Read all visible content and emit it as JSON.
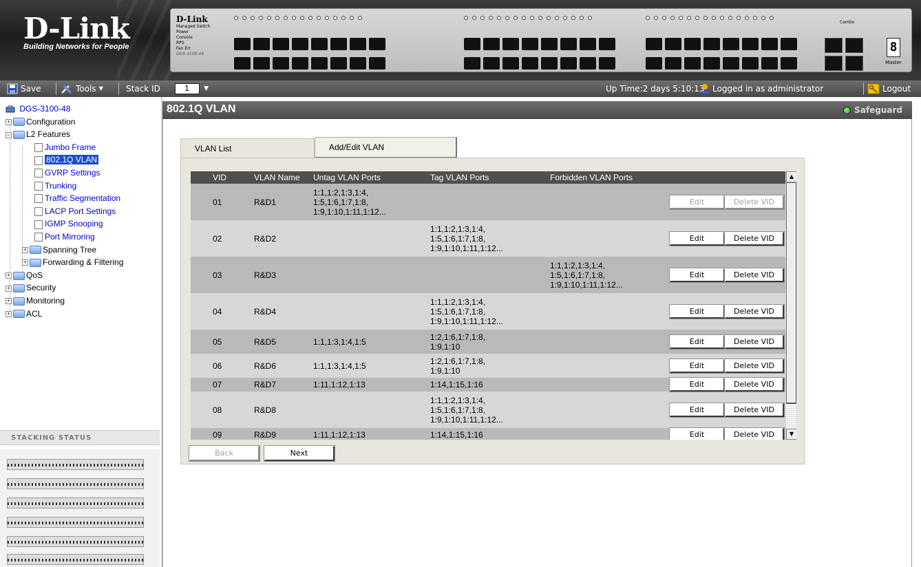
{
  "header": {
    "logo_brand": "D-Link",
    "logo_tagline": "Building Networks for People",
    "switch_brand": "D-Link",
    "switch_lines": [
      "Managed Switch",
      "Power",
      "Console",
      "RPS",
      "Fan Err"
    ],
    "switch_model": "DGS-3100-48",
    "master_digit": "8",
    "master_label": "Master",
    "combo_label": "Combo"
  },
  "toolbar": {
    "save_label": "Save",
    "tools_label": "Tools",
    "stack_id_label": "Stack ID",
    "stack_id_value": "1",
    "uptime_text": "Up Time:2 days 5:10:13",
    "logged_in_text": "Logged in as administrator",
    "logout_label": "Logout"
  },
  "sidebar": {
    "root": "DGS-3100-48",
    "configuration": "Configuration",
    "l2_features": "L2 Features",
    "l2_items": [
      "Jumbo Frame",
      "802.1Q VLAN",
      "GVRP Settings",
      "Trunking",
      "Traffic Segmentation",
      "LACP Port Settings",
      "IGMP Snooping",
      "Port Mirroring"
    ],
    "spanning_tree": "Spanning Tree",
    "forwarding": "Forwarding & Filtering",
    "qos": "QoS",
    "security": "Security",
    "monitoring": "Monitoring",
    "acl": "ACL",
    "stacking_status_title": "Stacking Status"
  },
  "main": {
    "title": "802.1Q VLAN",
    "safeguard_label": "Safeguard",
    "tabs": [
      {
        "label": "VLAN List"
      },
      {
        "label": "Add/Edit VLAN"
      }
    ],
    "columns": [
      "VID",
      "VLAN Name",
      "Untag VLAN Ports",
      "Tag VLAN Ports",
      "Forbidden VLAN Ports"
    ],
    "rows": [
      {
        "vid": "01",
        "name": "R&D1",
        "untag": [
          "1:1,1:2,1:3,1:4,",
          "1:5,1:6,1:7,1:8,",
          "1:9,1:10,1:11,1:12..."
        ],
        "tag": [],
        "forbidden": [],
        "edit_enabled": false
      },
      {
        "vid": "02",
        "name": "R&D2",
        "untag": [],
        "tag": [
          "1:1,1:2,1:3,1:4,",
          "1:5,1:6,1:7,1:8,",
          "1:9,1:10,1:11,1:12..."
        ],
        "forbidden": [],
        "edit_enabled": true
      },
      {
        "vid": "03",
        "name": "R&D3",
        "untag": [],
        "tag": [],
        "forbidden": [
          "1:1,1:2,1:3,1:4,",
          "1:5,1:6,1:7,1:8,",
          "1:9,1:10,1:11,1:12..."
        ],
        "edit_enabled": true
      },
      {
        "vid": "04",
        "name": "R&D4",
        "untag": [],
        "tag": [
          "1:1,1:2,1:3,1:4,",
          "1:5,1:6,1:7,1:8,",
          "1:9,1:10,1:11,1:12..."
        ],
        "forbidden": [],
        "edit_enabled": true
      },
      {
        "vid": "05",
        "name": "R&D5",
        "untag": [
          "1:1,1:3,1:4,1:5"
        ],
        "tag": [
          "1:2,1:6,1:7,1:8,",
          "1:9,1:10"
        ],
        "forbidden": [],
        "edit_enabled": true
      },
      {
        "vid": "06",
        "name": "R&D6",
        "untag": [
          "1:1,1:3,1:4,1:5"
        ],
        "tag": [
          "1:2,1:6,1:7,1:8,",
          "1:9,1:10"
        ],
        "forbidden": [],
        "edit_enabled": true
      },
      {
        "vid": "07",
        "name": "R&D7",
        "untag": [
          "1:11,1:12,1:13"
        ],
        "tag": [
          "1:14,1:15,1:16"
        ],
        "forbidden": [],
        "edit_enabled": true
      },
      {
        "vid": "08",
        "name": "R&D8",
        "untag": [],
        "tag": [
          "1:1,1:2,1:3,1:4,",
          "1:5,1:6,1:7,1:8,",
          "1:9,1:10,1:11,1:12..."
        ],
        "forbidden": [],
        "edit_enabled": true
      },
      {
        "vid": "09",
        "name": "R&D9",
        "untag": [
          "1:11,1:12,1:13"
        ],
        "tag": [
          "1:14,1:15,1:16"
        ],
        "forbidden": [],
        "edit_enabled": true
      }
    ],
    "edit_label": "Edit",
    "delete_label": "Delete VID",
    "back_label": "Back",
    "next_label": "Next"
  },
  "colors": {
    "header_dark": "#2a2a2a",
    "table_header": "#4f4f4f",
    "row_dark": "#b9b9b9",
    "row_light": "#d7d7d7",
    "panel": "#e8e6dd",
    "selected_nav": "#1a4ccc"
  }
}
